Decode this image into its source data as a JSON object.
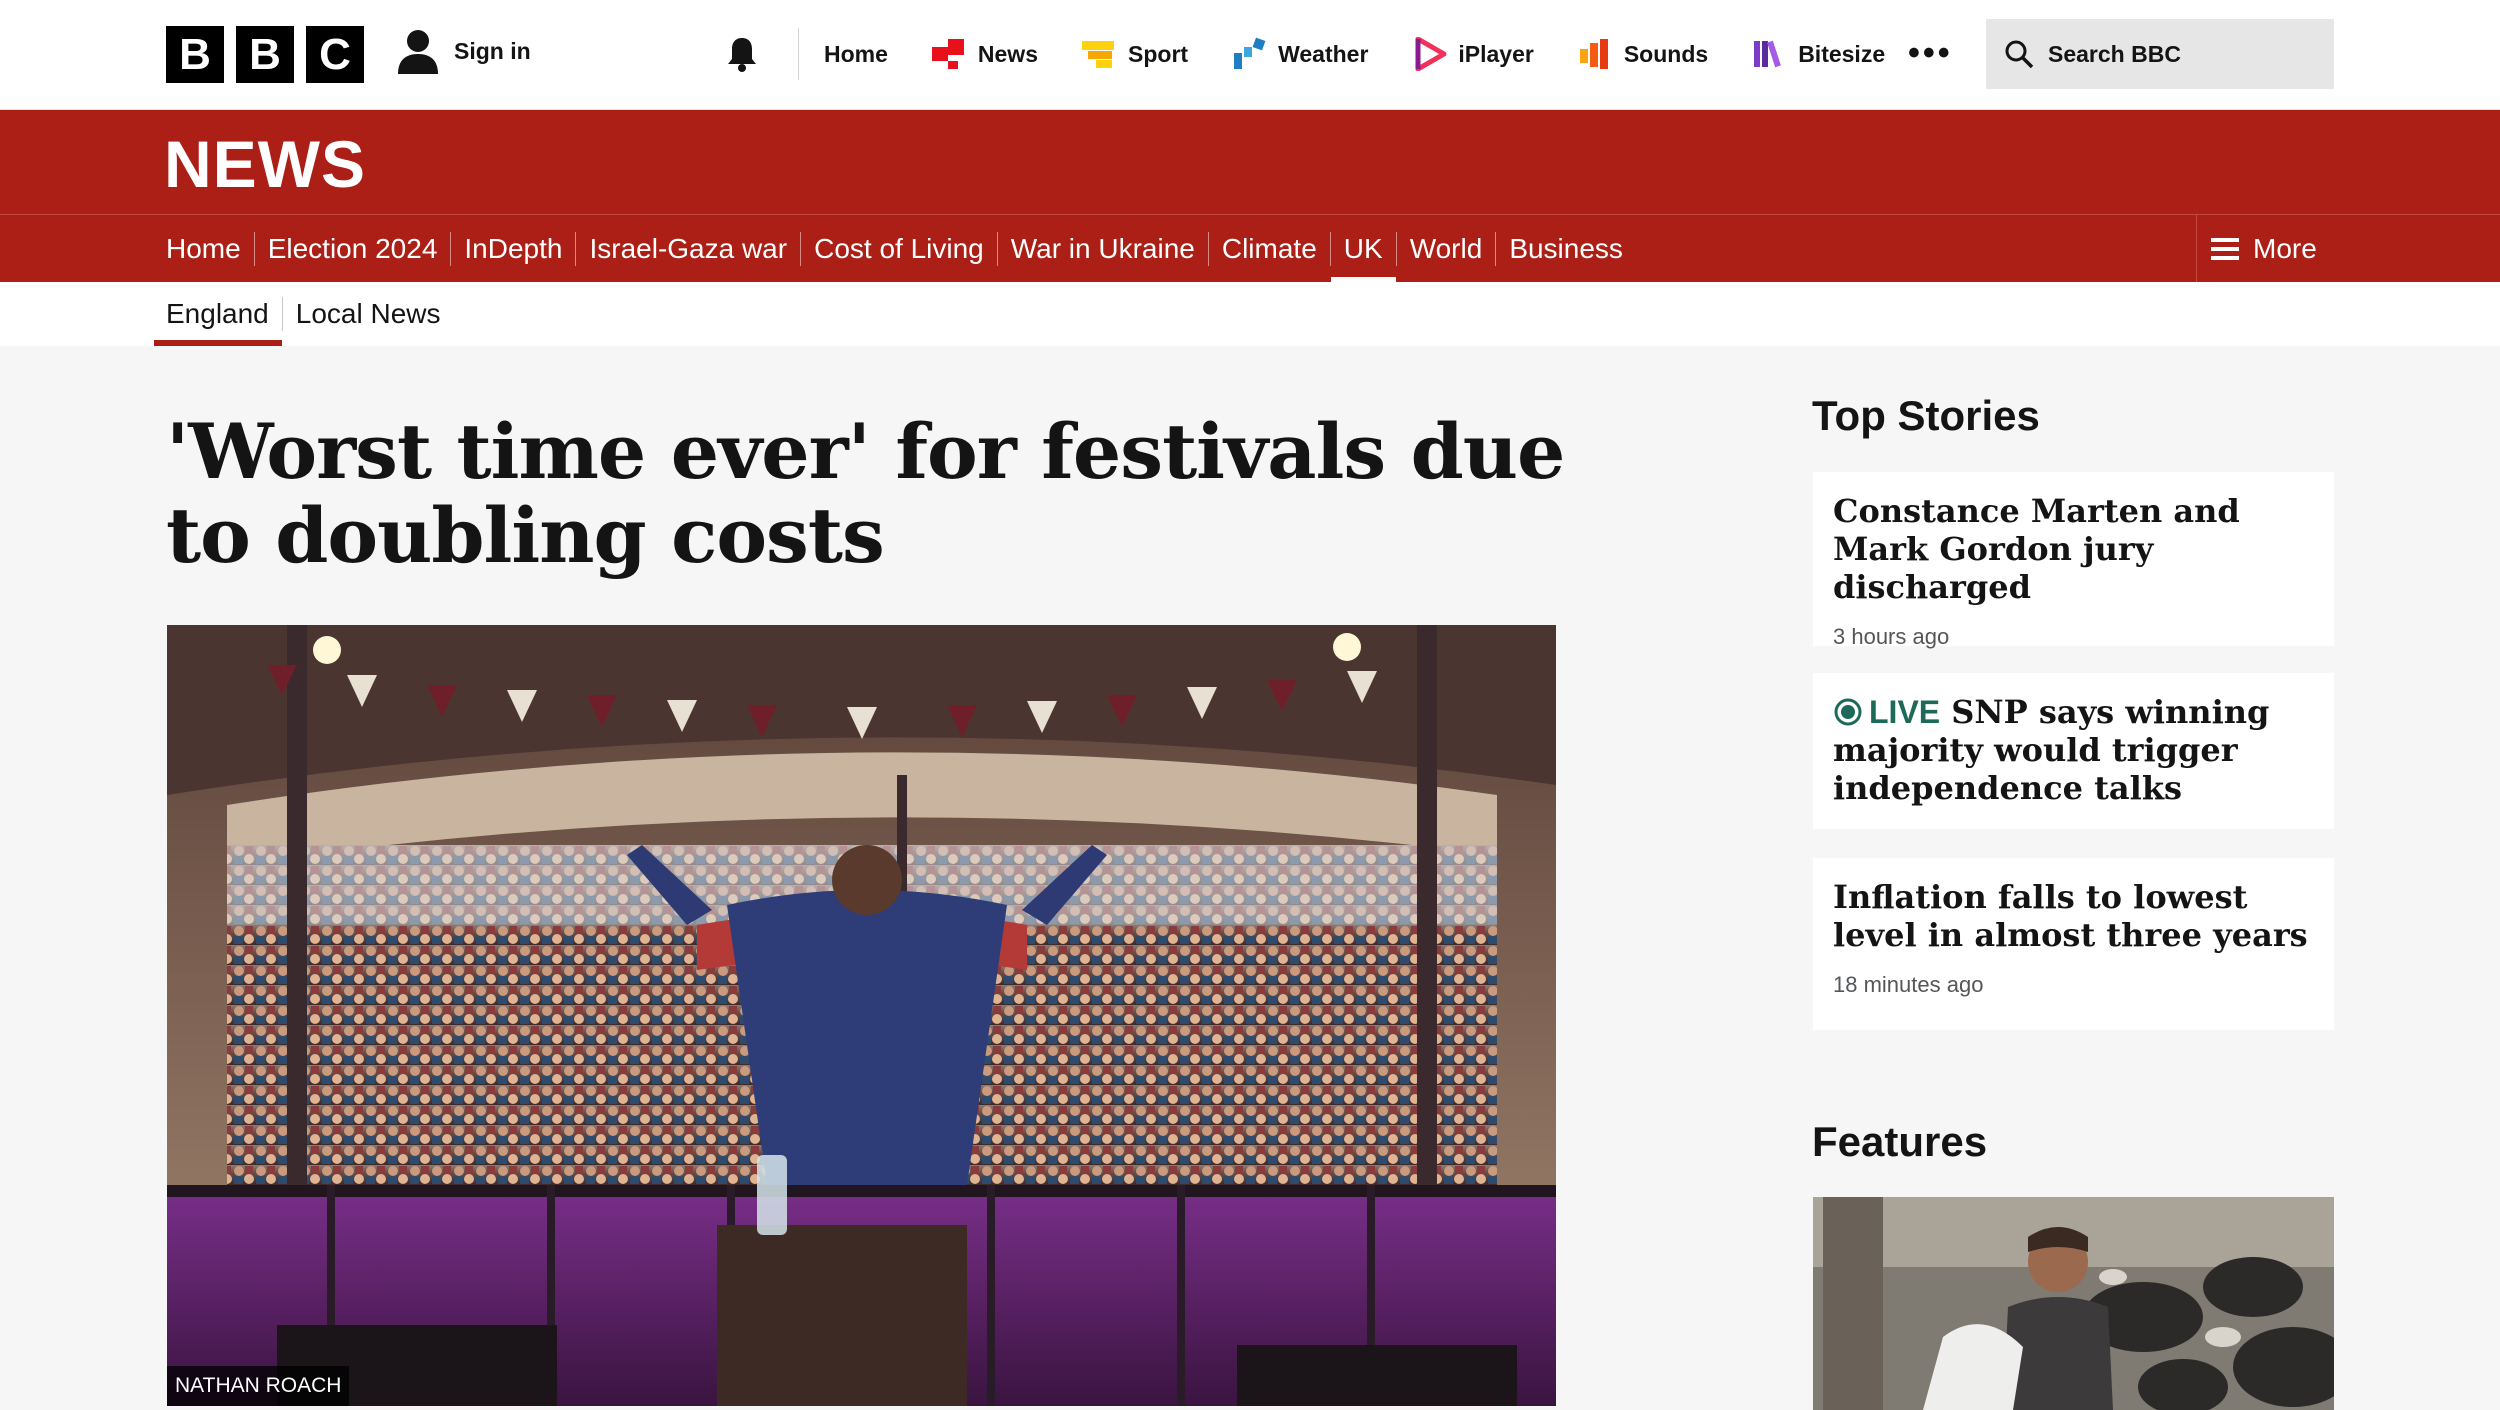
{
  "masthead": {
    "logo_letters": [
      "B",
      "B",
      "C"
    ],
    "signin_label": "Sign in",
    "nav": [
      {
        "label": "Home",
        "icon": "none"
      },
      {
        "label": "News",
        "icon": "news-icon",
        "color": "#e8101a"
      },
      {
        "label": "Sport",
        "icon": "sport-icon",
        "color": "#fcd20d"
      },
      {
        "label": "Weather",
        "icon": "weather-icon",
        "color": "#1f7dc4"
      },
      {
        "label": "iPlayer",
        "icon": "iplayer-icon",
        "color": "#f0325b"
      },
      {
        "label": "Sounds",
        "icon": "sounds-icon",
        "color": "#f55b11"
      },
      {
        "label": "Bitesize",
        "icon": "bitesize-icon",
        "color": "#7d3cc8"
      }
    ],
    "more_label": "•••",
    "search_placeholder": "Search BBC"
  },
  "news_bar": {
    "title": "NEWS",
    "nav": [
      "Home",
      "Election 2024",
      "InDepth",
      "Israel-Gaza war",
      "Cost of Living",
      "War in Ukraine",
      "Climate",
      "UK",
      "World",
      "Business"
    ],
    "active": "UK",
    "more_label": "More"
  },
  "region_nav": {
    "items": [
      "England",
      "Local News"
    ],
    "active": "England"
  },
  "article": {
    "headline": "'Worst time ever' for festivals due to doubling costs",
    "image_credit": "NATHAN ROACH"
  },
  "sidebar": {
    "top_stories_heading": "Top Stories",
    "stories": [
      {
        "title": "Constance Marten and Mark Gordon jury discharged",
        "time": "3 hours ago",
        "live": false
      },
      {
        "title": "SNP says winning majority would trigger independence talks",
        "time": "",
        "live": true,
        "live_label": "LIVE"
      },
      {
        "title": "Inflation falls to lowest level in almost three years",
        "time": "18 minutes ago",
        "live": false
      }
    ],
    "features_heading": "Features"
  },
  "colors": {
    "news_red": "#ab1f16",
    "live_green": "#1e6a59",
    "page_bg": "#f6f6f6"
  }
}
